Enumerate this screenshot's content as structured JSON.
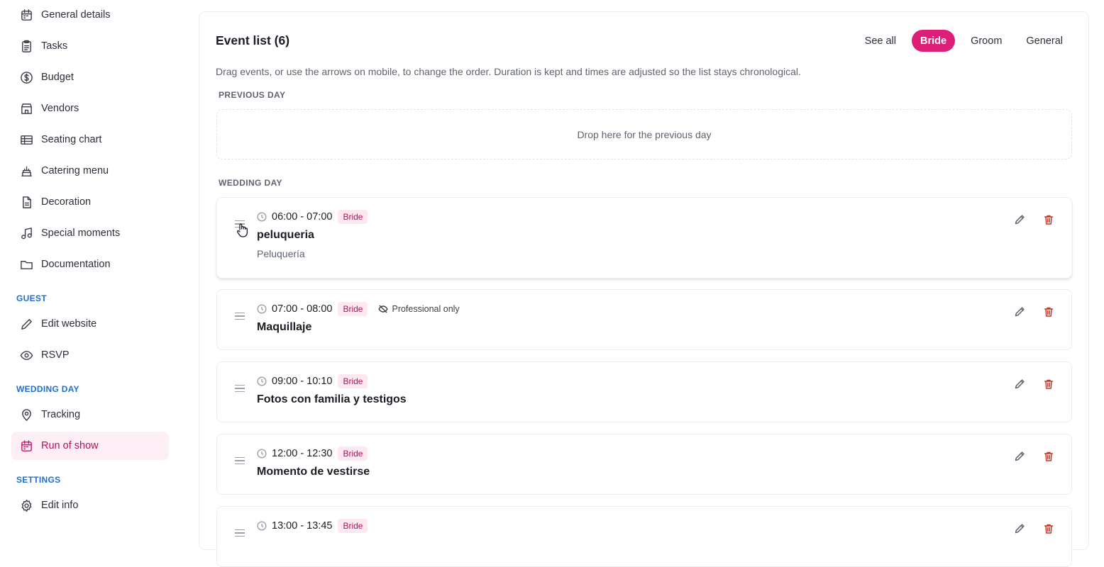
{
  "sidebar": {
    "items": [
      {
        "label": "General details",
        "icon": "calendar-icon"
      },
      {
        "label": "Tasks",
        "icon": "clipboard-icon"
      },
      {
        "label": "Budget",
        "icon": "dollar-circle-icon"
      },
      {
        "label": "Vendors",
        "icon": "store-icon"
      },
      {
        "label": "Seating chart",
        "icon": "table-icon"
      },
      {
        "label": "Catering menu",
        "icon": "cake-icon"
      },
      {
        "label": "Decoration",
        "icon": "document-icon"
      },
      {
        "label": "Special moments",
        "icon": "music-note-icon"
      },
      {
        "label": "Documentation",
        "icon": "folder-icon"
      }
    ],
    "guest_label": "GUEST",
    "guest_items": [
      {
        "label": "Edit website",
        "icon": "pencil-icon"
      },
      {
        "label": "RSVP",
        "icon": "eye-icon"
      }
    ],
    "wedding_label": "WEDDING DAY",
    "wedding_items": [
      {
        "label": "Tracking",
        "icon": "map-pin-icon"
      },
      {
        "label": "Run of show",
        "icon": "calendar-icon",
        "active": true
      }
    ],
    "settings_label": "SETTINGS",
    "settings_items": [
      {
        "label": "Edit info",
        "icon": "gear-icon"
      }
    ]
  },
  "main": {
    "title": "Event list (6)",
    "filters": [
      "See all",
      "Bride",
      "Groom",
      "General"
    ],
    "active_filter": "Bride",
    "helper_text": "Drag events, or use the arrows on mobile, to change the order. Duration is kept and times are adjusted so the list stays chronological.",
    "previous_day_label": "PREVIOUS DAY",
    "dropzone_text": "Drop here for the previous day",
    "wedding_day_label": "WEDDING DAY",
    "events": [
      {
        "time": "06:00 - 07:00",
        "tag": "Bride",
        "title": "peluqueria",
        "subtitle": "Peluquería"
      },
      {
        "time": "07:00 - 08:00",
        "tag": "Bride",
        "private": "Professional only",
        "title": "Maquillaje"
      },
      {
        "time": "09:00 - 10:10",
        "tag": "Bride",
        "title": "Fotos con familia y testigos"
      },
      {
        "time": "12:00 - 12:30",
        "tag": "Bride",
        "title": "Momento de vestirse"
      },
      {
        "time": "13:00 - 13:45",
        "tag": "Bride",
        "title": ""
      }
    ]
  },
  "colors": {
    "accent": "#dd1f78",
    "section_label": "#1e6fd0",
    "badge_bg": "#fde7f1",
    "delete": "#c0392b"
  }
}
